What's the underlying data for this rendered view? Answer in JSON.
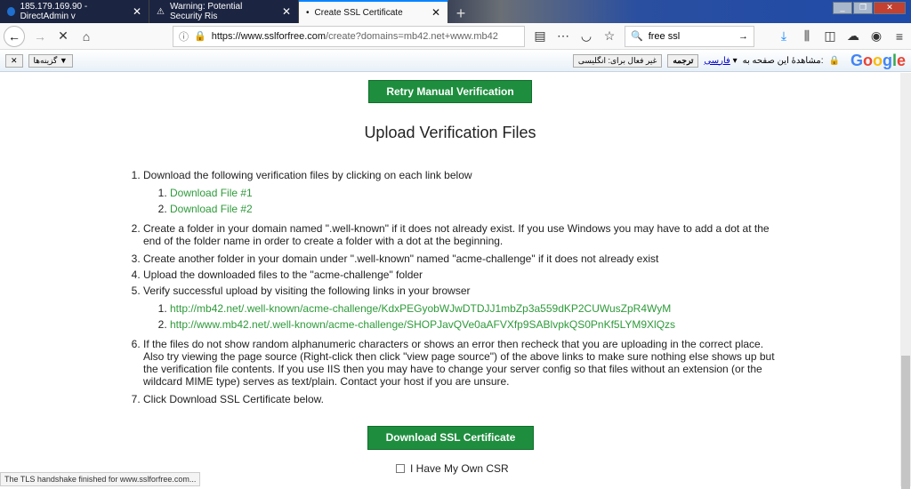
{
  "tabs": [
    {
      "label": "185.179.169.90 - DirectAdmin v",
      "icon": "globe-icon"
    },
    {
      "label": "Warning: Potential Security Ris",
      "icon": "warning-icon"
    },
    {
      "label": "Create SSL Certificate",
      "icon": "loading-dot"
    }
  ],
  "nav": {
    "url_host": "https://www.sslforfree.com",
    "url_path": "/create?domains=mb42.net+www.mb42",
    "search_value": "free ssl"
  },
  "translate": {
    "options_label": "گزینه‌ها ▼",
    "view_label": "مشاهدهٔ این صفحه به:",
    "language": "فارسی",
    "translate_button": "ترجمه",
    "disable_button": "غیر فعال برای: انگلیسی",
    "brand": "Google"
  },
  "page": {
    "retry_button": "Retry Manual Verification",
    "title": "Upload Verification Files",
    "steps": [
      "Download the following verification files by clicking on each link below",
      "Create a folder in your domain named \".well-known\" if it does not already exist. If you use Windows you may have to add a dot at the end of the folder name in order to create a folder with a dot at the beginning.",
      "Create another folder in your domain under \".well-known\" named \"acme-challenge\" if it does not already exist",
      "Upload the downloaded files to the \"acme-challenge\" folder",
      "Verify successful upload by visiting the following links in your browser",
      "If the files do not show random alphanumeric characters or shows an error then recheck that you are uploading in the correct place. Also try viewing the page source (Right-click then click \"view page source\") of the above links to make sure nothing else shows up but the verification file contents. If you use IIS then you may have to change your server config so that files without an extension (or the wildcard MIME type) serves as text/plain. Contact your host if you are unsure.",
      "Click Download SSL Certificate below."
    ],
    "download_links": [
      "Download File #1",
      "Download File #2"
    ],
    "verify_links": [
      "http://mb42.net/.well-known/acme-challenge/KdxPEGyobWJwDTDJJ1mbZp3a559dKP2CUWusZpR4WyM",
      "http://www.mb42.net/.well-known/acme-challenge/SHOPJavQVe0aAFVXfp9SABlvpkQS0PnKf5LYM9XlQzs"
    ],
    "download_button": "Download SSL Certificate",
    "csr_label": "I Have My Own CSR"
  },
  "status": "The TLS handshake finished for www.sslforfree.com...",
  "colors": {
    "accent": "#1e8e3e",
    "link": "#2e9a3a"
  }
}
